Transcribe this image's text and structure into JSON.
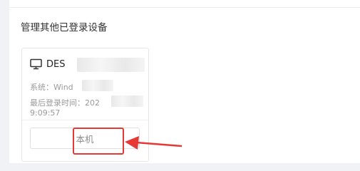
{
  "settings": {
    "section_title": "管理其他已登录设备"
  },
  "device": {
    "icon": "monitor-icon",
    "name_visible": "DES",
    "os_label": "系统：Wind",
    "last_login_label": "最后登录时间：202",
    "last_login_time": "9:09:57",
    "button_label": "本机"
  },
  "colors": {
    "highlight": "#e53935",
    "background": "#f0f2f5",
    "panel": "#ffffff"
  }
}
